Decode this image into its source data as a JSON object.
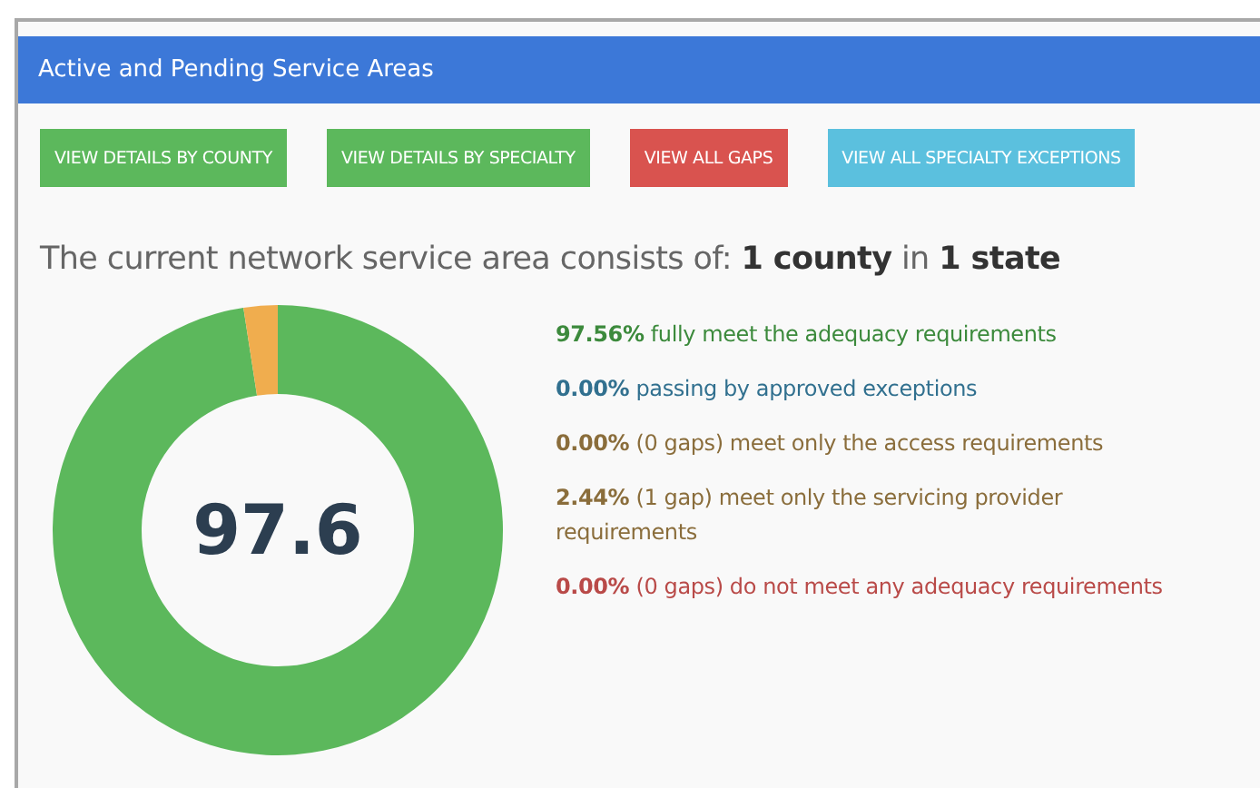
{
  "panel": {
    "title": "Active and Pending Service Areas"
  },
  "buttons": [
    {
      "label": "VIEW DETAILS BY COUNTY",
      "kind": "success"
    },
    {
      "label": "VIEW DETAILS BY SPECIALTY",
      "kind": "success"
    },
    {
      "label": "VIEW ALL GAPS",
      "kind": "danger"
    },
    {
      "label": "VIEW ALL SPECIALTY EXCEPTIONS",
      "kind": "info"
    }
  ],
  "summary": "The current network service area consists of: **1 county** in **1 state**",
  "gauge": {
    "center_value": "97.6"
  },
  "legend": [
    {
      "text": "**97.56%** fully meet the adequacy requirements",
      "color": "#3c8a3c"
    },
    {
      "text": "**0.00%** passing by approved exceptions",
      "color": "#31708f"
    },
    {
      "text": "**0.00%** (0 gaps) meet only the access requirements",
      "color": "#8a6d3b"
    },
    {
      "text": "**2.44%** (1 gap) meet only the servicing provider requirements",
      "color": "#8a6d3b"
    },
    {
      "text": "**0.00%** (0 gaps) do not meet any adequacy requirements",
      "color": "#b94a48"
    }
  ]
}
